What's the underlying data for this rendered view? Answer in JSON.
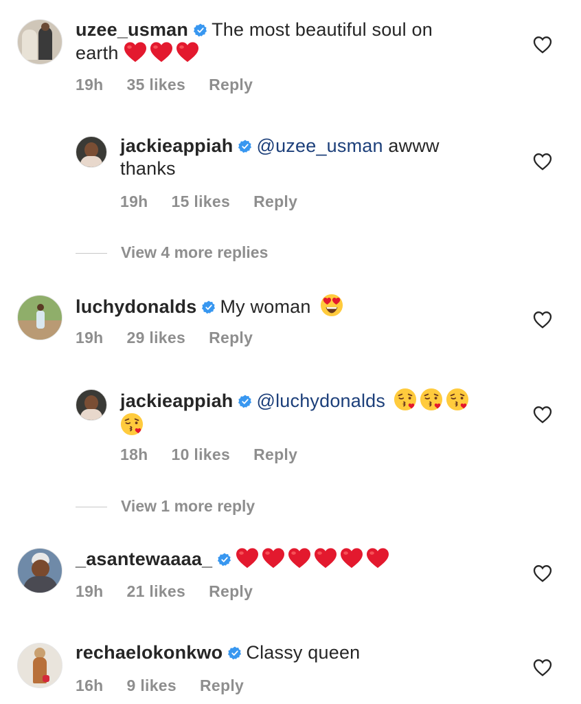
{
  "comments": [
    {
      "username": "uzee_usman",
      "text": "The most beautiful soul on",
      "text2": "earth",
      "time": "19h",
      "likes": "35 likes",
      "reply": "Reply"
    },
    {
      "username": "jackieappiah",
      "mention": "@uzee_usman",
      "text": " awww",
      "text2": "thanks",
      "time": "19h",
      "likes": "15 likes",
      "reply": "Reply"
    },
    {
      "view_more": "View 4 more replies"
    },
    {
      "username": "luchydonalds",
      "text": "My woman",
      "time": "19h",
      "likes": "29 likes",
      "reply": "Reply"
    },
    {
      "username": "jackieappiah",
      "mention": "@luchydonalds",
      "time": "18h",
      "likes": "10 likes",
      "reply": "Reply"
    },
    {
      "view_more": "View 1 more reply"
    },
    {
      "username": "_asantewaaaa_",
      "time": "19h",
      "likes": "21 likes",
      "reply": "Reply"
    },
    {
      "username": "rechaelokonkwo",
      "text": "Classy queen",
      "time": "16h",
      "likes": "9 likes",
      "reply": "Reply"
    }
  ],
  "icons": {
    "verified": "verified-badge-icon",
    "like": "heart-outline-icon",
    "red_heart": "red-heart-emoji",
    "heart_eyes": "heart-eyes-emoji",
    "kiss": "face-blowing-kiss-emoji"
  },
  "colors": {
    "verified": "#3897f0",
    "meta": "#8e8e8e",
    "mention": "#1c3f7a",
    "heart_emoji": "#e3192e"
  }
}
